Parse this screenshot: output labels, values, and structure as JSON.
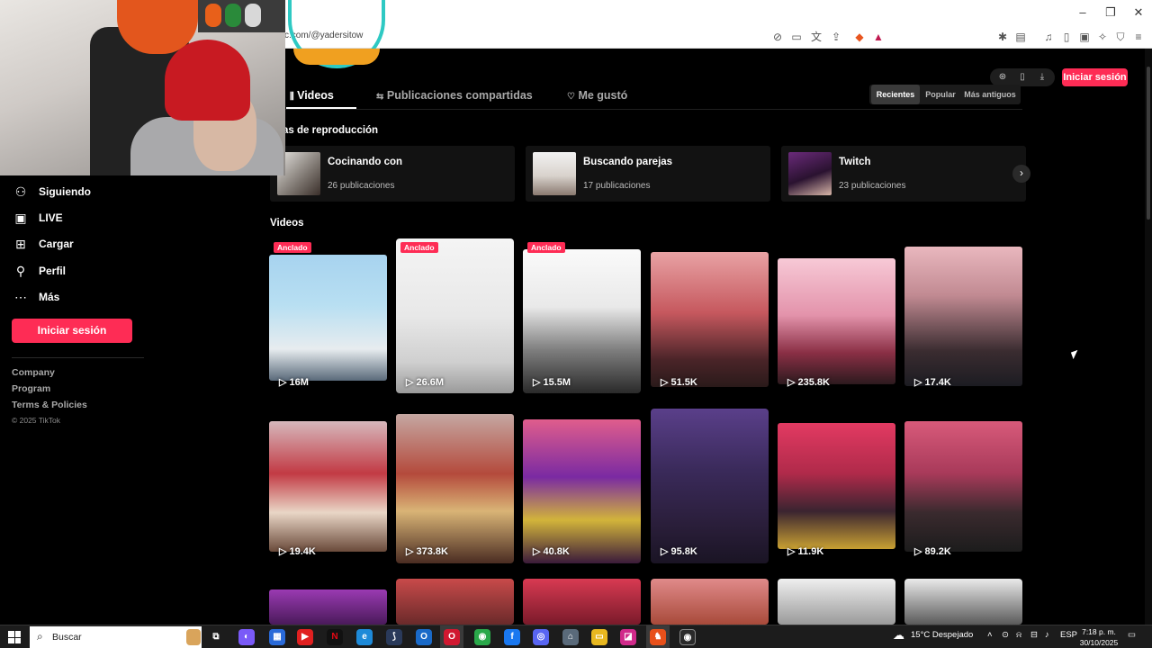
{
  "browser": {
    "url": "c.com/@yadersitow",
    "window_controls": [
      "minimize",
      "restore",
      "close"
    ],
    "toolbar_icons": [
      "translate-icon",
      "screenshot-icon",
      "share-icon",
      "brave-shield-icon",
      "brave-rewards-icon",
      "extensions-icon",
      "reading-list-icon",
      "media-icon",
      "sidebar-icon",
      "wallet-icon",
      "leo-icon",
      "vpn-icon",
      "menu-icon"
    ]
  },
  "sidebar": {
    "items": [
      {
        "label": "Siguiendo",
        "icon": "following-icon"
      },
      {
        "label": "LIVE",
        "icon": "live-icon"
      },
      {
        "label": "Cargar",
        "icon": "upload-icon"
      },
      {
        "label": "Perfil",
        "icon": "profile-icon"
      },
      {
        "label": "Más",
        "icon": "more-icon"
      }
    ],
    "login_label": "Iniciar sesión",
    "footer": [
      "Company",
      "Program",
      "Terms & Policies"
    ],
    "copyright": "© 2025 TikTok"
  },
  "header": {
    "login_label": "Iniciar sesión",
    "tabs": [
      {
        "label": "Videos",
        "icon": "grid-icon",
        "active": true
      },
      {
        "label": "Publicaciones compartidas",
        "icon": "repost-icon",
        "active": false
      },
      {
        "label": "Me gustó",
        "icon": "heart-lock-icon",
        "active": false
      }
    ],
    "sort": [
      {
        "label": "Recientes",
        "active": true
      },
      {
        "label": "Popular",
        "active": false
      },
      {
        "label": "Más antiguos",
        "active": false
      }
    ]
  },
  "playlists": {
    "title": "as de reproducción",
    "items": [
      {
        "title": "Cocinando con",
        "count": "26 publicaciones"
      },
      {
        "title": "Buscando parejas",
        "count": "17 publicaciones"
      },
      {
        "title": "Twitch",
        "count": "23 publicaciones"
      }
    ]
  },
  "videos": {
    "title": "Videos",
    "pinned_label": "Anclado",
    "row1": [
      {
        "views": "16M",
        "pinned": true
      },
      {
        "views": "26.6M",
        "pinned": true
      },
      {
        "views": "15.5M",
        "pinned": true
      },
      {
        "views": "51.5K",
        "pinned": false
      },
      {
        "views": "235.8K",
        "pinned": false
      },
      {
        "views": "17.4K",
        "pinned": false
      }
    ],
    "row2": [
      {
        "views": "19.4K"
      },
      {
        "views": "373.8K"
      },
      {
        "views": "40.8K"
      },
      {
        "views": "95.8K"
      },
      {
        "views": "11.9K"
      },
      {
        "views": "89.2K"
      }
    ]
  },
  "taskbar": {
    "search_placeholder": "Buscar",
    "weather": "15°C  Despejado",
    "language": "ESP",
    "time": "7:18 p. m.",
    "date": "30/10/2025"
  },
  "colors": {
    "accent": "#fe2c55",
    "background": "#000000"
  }
}
